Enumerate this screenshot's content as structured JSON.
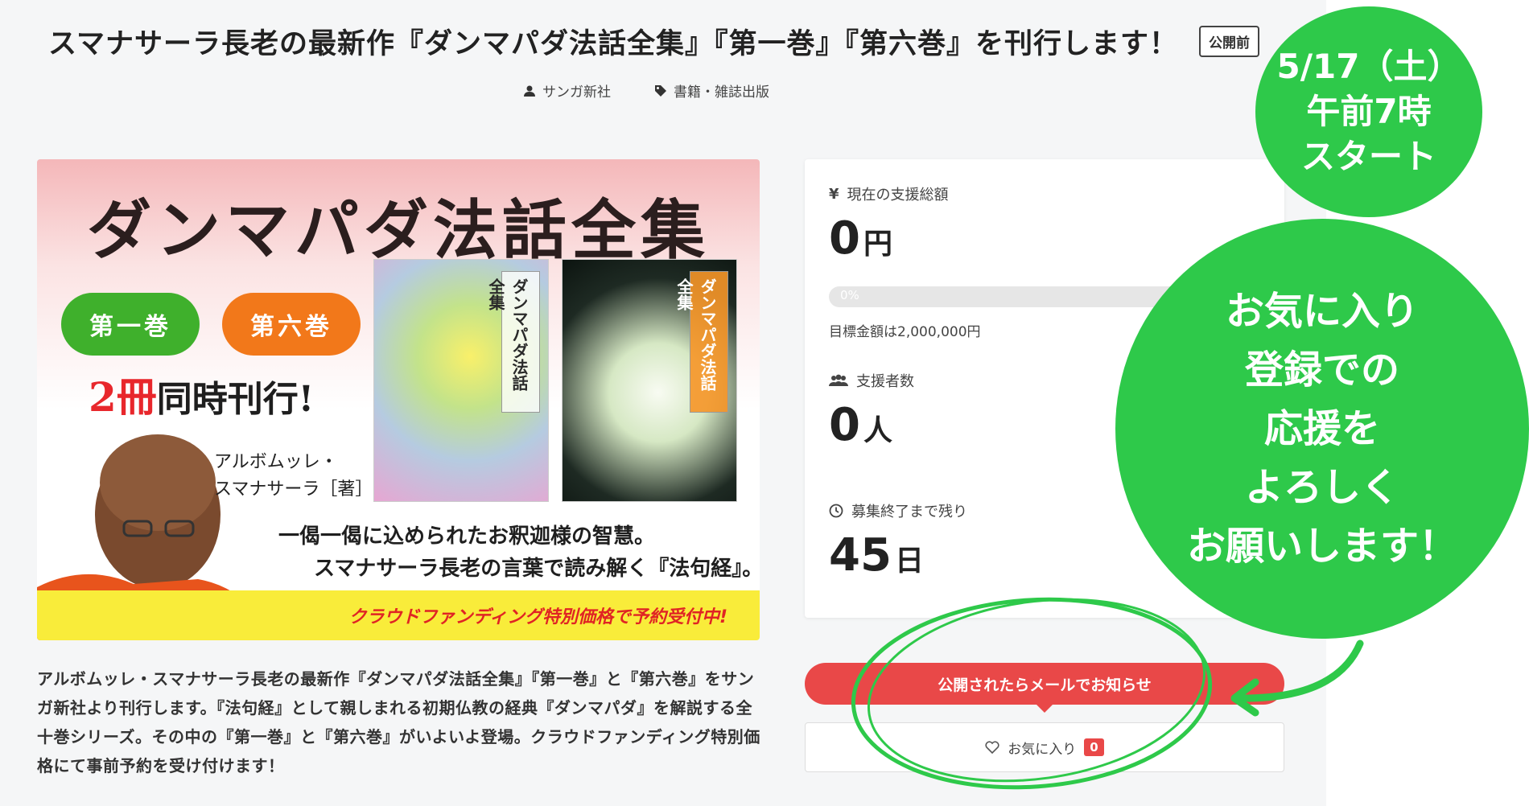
{
  "header": {
    "title": "スマナサーラ長老の最新作『ダンマパダ法話全集』『第一巻』『第六巻』を刊行します！",
    "status_badge": "公開前",
    "author": "サンガ新社",
    "category": "書籍・雑誌出版"
  },
  "hero": {
    "title": "ダンマパダ法話全集",
    "volume1": "第一巻",
    "volume6": "第六巻",
    "simul_count": "2冊",
    "simul_text": "同時刊行!",
    "author_line1": "アルボムッレ・",
    "author_line2": "スマナサーラ［著］",
    "cover_label1": "ダンマパダ法話全集",
    "cover_label6": "ダンマパダ法話全集",
    "quote1": "一偈一偈に込められたお釈迦様の智慧。",
    "quote2": "スマナサーラ長老の言葉で読み解く『法句経』。",
    "banner": "クラウドファンディング特別価格で予約受付中!"
  },
  "description": "アルボムッレ・スマナサーラ長老の最新作『ダンマパダ法話全集』『第一巻』と『第六巻』をサンガ新社より刊行します。『法句経』として親しまれる初期仏教の経典『ダンマパダ』を解説する全十巻シリーズ。その中の『第一巻』と『第六巻』がいよいよ登場。クラウドファンディング特別価格にて事前予約を受け付けます！",
  "stats": {
    "total_label": "現在の支援総額",
    "total_value": "0",
    "total_unit": "円",
    "progress_text": "0%",
    "progress_fraction": 0,
    "goal_text": "目標金額は2,000,000円",
    "supporters_label": "支援者数",
    "supporters_value": "0",
    "supporters_unit": "人",
    "remaining_label": "募集終了まで残り",
    "remaining_value": "45",
    "remaining_unit": "日"
  },
  "actions": {
    "notify_label": "公開されたらメールでお知らせ",
    "favorite_label": "お気に入り",
    "favorite_count": "0"
  },
  "overlay": {
    "small_line1": "5/17（土）",
    "small_line2": "午前7時",
    "small_line3": "スタート",
    "big_line1": "お気に入り",
    "big_line2": "登録での",
    "big_line3": "応援を",
    "big_line4": "よろしく",
    "big_line5": "お願いします！",
    "overlay_color": "#2ec94a"
  },
  "colors": {
    "accent_red": "#e94848",
    "green": "#3fb02c",
    "orange": "#f2781a",
    "banner_yellow": "#f9ec3a"
  }
}
